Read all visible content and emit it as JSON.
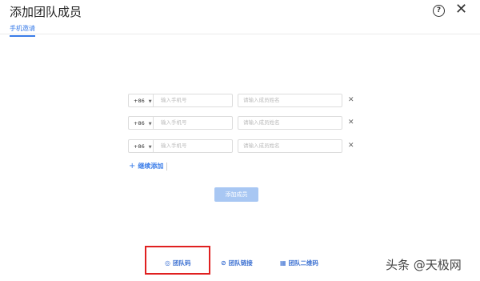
{
  "header": {
    "title": "添加团队成员",
    "help_icon": "help-circle-icon",
    "close_icon": "close-icon"
  },
  "tabs": [
    {
      "label": "手机邀请",
      "active": true
    }
  ],
  "form": {
    "rows": [
      {
        "country_code": "+86",
        "phone_placeholder": "输入手机号",
        "name_placeholder": "请输入成员姓名"
      },
      {
        "country_code": "+86",
        "phone_placeholder": "输入手机号",
        "name_placeholder": "请输入成员姓名"
      },
      {
        "country_code": "+86",
        "phone_placeholder": "输入手机号",
        "name_placeholder": "请输入成员姓名"
      }
    ],
    "remove_glyph": "✕",
    "add_more_label": "继续添加",
    "submit_label": "添加成员"
  },
  "footer": {
    "team_code": "团队码",
    "team_link": "团队链接",
    "team_qrcode": "团队二维码"
  },
  "watermark": "头条 @天极网",
  "colors": {
    "accent": "#3a7ce8",
    "submit_disabled": "#a8c7f3",
    "highlight": "#e02020"
  }
}
